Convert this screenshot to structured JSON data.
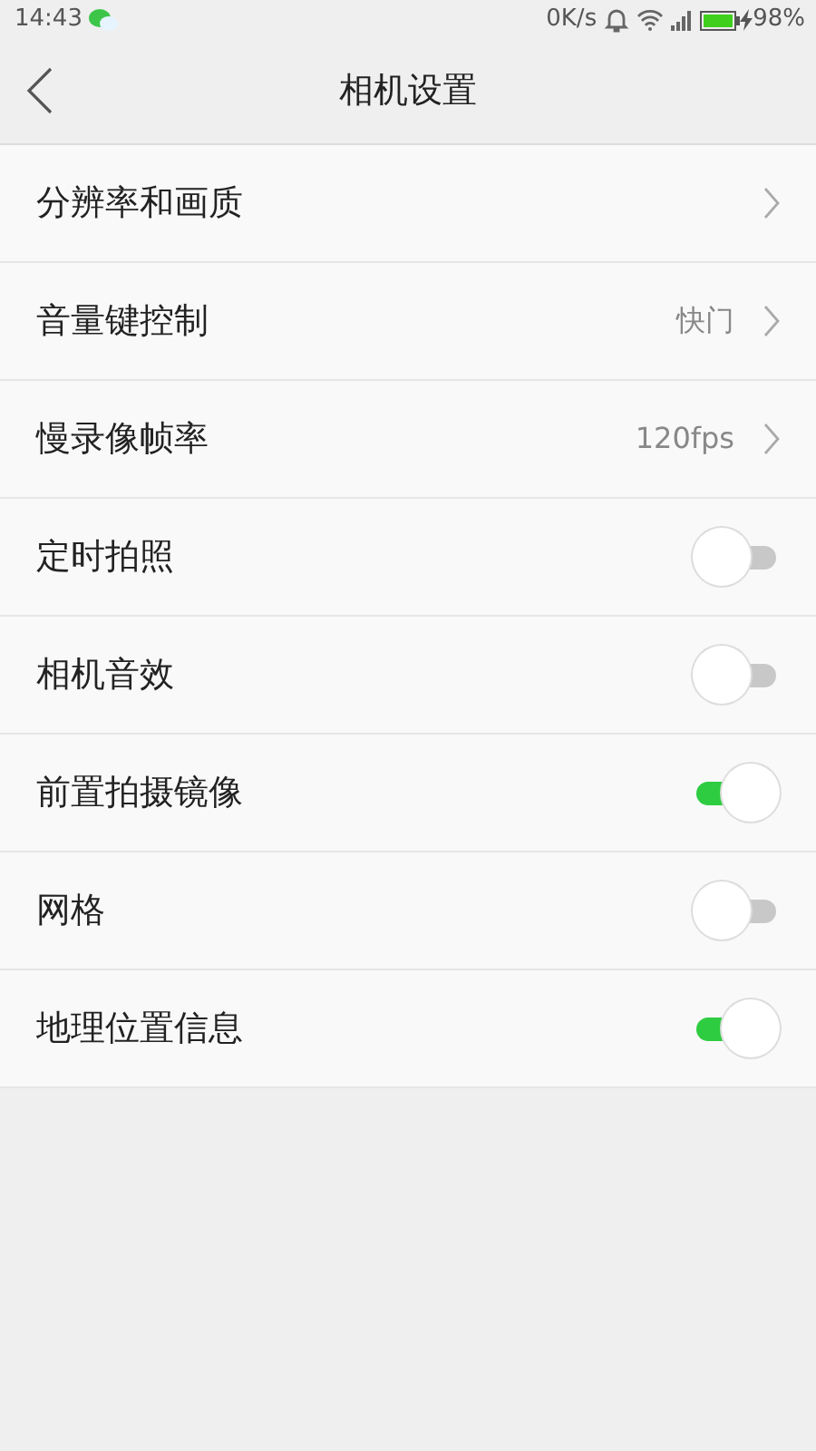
{
  "status_bar": {
    "time": "14:43",
    "speed": "0K/s",
    "battery": "98%"
  },
  "header": {
    "title": "相机设置"
  },
  "items": [
    {
      "kind": "link",
      "label": "分辨率和画质"
    },
    {
      "kind": "link",
      "label": "音量键控制",
      "value": "快门"
    },
    {
      "kind": "link",
      "label": "慢录像帧率",
      "value": "120fps"
    },
    {
      "kind": "toggle",
      "label": "定时拍照",
      "on": false
    },
    {
      "kind": "toggle",
      "label": "相机音效",
      "on": false
    },
    {
      "kind": "toggle",
      "label": "前置拍摄镜像",
      "on": true
    },
    {
      "kind": "toggle",
      "label": "网格",
      "on": false
    },
    {
      "kind": "toggle",
      "label": "地理位置信息",
      "on": true
    }
  ]
}
